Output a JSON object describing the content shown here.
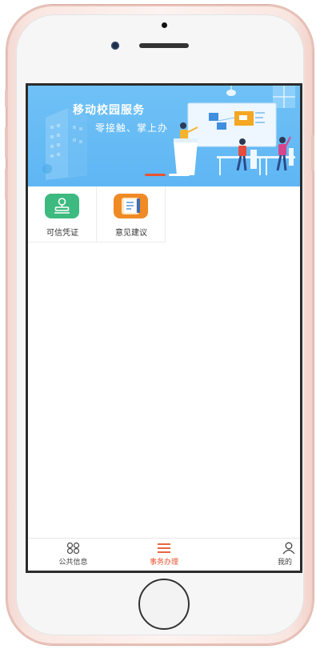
{
  "banner": {
    "title": "移动校园服务",
    "subtitle": "零接触、掌上办"
  },
  "services": [
    {
      "label": "可信凭证",
      "icon": "stamp-icon",
      "color": "#3dba7f"
    },
    {
      "label": "意见建议",
      "icon": "notebook-icon",
      "color": "#f08a24"
    }
  ],
  "tabbar": {
    "items": [
      {
        "label": "公共信息",
        "icon": "grid-icon",
        "active": false
      },
      {
        "label": "事务办理",
        "icon": "menu-icon",
        "active": true
      },
      {
        "label": "我的",
        "icon": "user-icon",
        "active": false
      }
    ],
    "active_color": "#e8542e",
    "inactive_color": "#444444"
  },
  "carousel": {
    "slide_count": 2,
    "active_index": 0
  }
}
